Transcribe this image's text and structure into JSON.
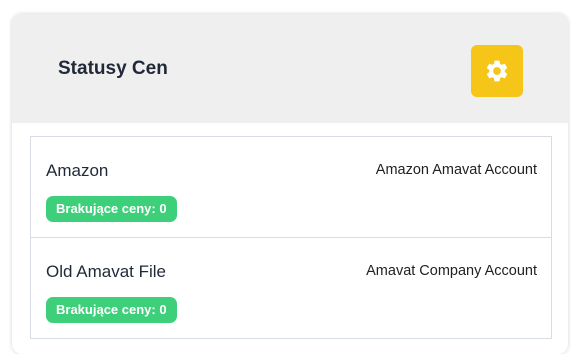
{
  "panel": {
    "title": "Statusy Cen",
    "settings_icon": "gear-icon",
    "accent_color": "#f5c518"
  },
  "items": [
    {
      "name": "Amazon",
      "account": "Amazon Amavat Account",
      "badge": "Brakujące ceny: 0"
    },
    {
      "name": "Old Amavat File",
      "account": "Amavat Company Account",
      "badge": "Brakujące ceny: 0"
    }
  ],
  "colors": {
    "badge": "#3ecf7a",
    "header_bg": "#efefef"
  }
}
